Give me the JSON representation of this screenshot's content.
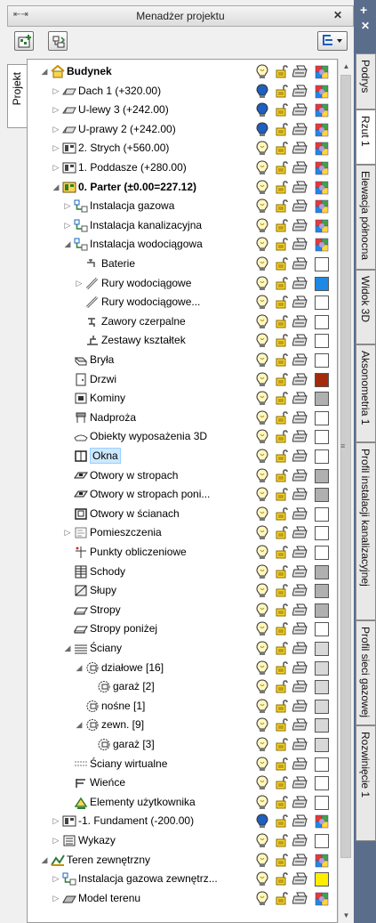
{
  "window": {
    "title": "Menadżer projektu",
    "pin_label": "⇤⇥",
    "close_label": "✕"
  },
  "left_tab": {
    "label": "Projekt"
  },
  "right_tabs": [
    {
      "label": "Podrys"
    },
    {
      "label": "Rzut 1"
    },
    {
      "label": "Elewacja północna"
    },
    {
      "label": "Widok 3D"
    },
    {
      "label": "Aksonometria 1"
    },
    {
      "label": "Profil instalacji kanalizacyjnej"
    },
    {
      "label": "Profil sieci gazowej"
    },
    {
      "label": "Rozwinięcie 1"
    }
  ],
  "tree": {
    "rows": [
      {
        "label": "Budynek",
        "arrow": "◢",
        "icon": "house-icon",
        "bold": true,
        "bulb": "yellow",
        "swatch": "multi"
      },
      {
        "label": "Dach 1 (+320.00)",
        "arrow": "▷",
        "icon": "roof-icon",
        "bulb": "blue",
        "swatch": "multi"
      },
      {
        "label": "U-lewy 3 (+242.00)",
        "arrow": "▷",
        "icon": "roof-icon",
        "bulb": "blue",
        "swatch": "multi"
      },
      {
        "label": "U-prawy 2 (+242.00)",
        "arrow": "▷",
        "icon": "roof-icon",
        "bulb": "blue",
        "swatch": "multi"
      },
      {
        "label": "2. Strych (+560.00)",
        "arrow": "▷",
        "icon": "floor-icon",
        "bulb": "yellow",
        "swatch": "multi"
      },
      {
        "label": "1. Poddasze (+280.00)",
        "arrow": "▷",
        "icon": "floor-icon",
        "bulb": "yellow",
        "swatch": "multi"
      },
      {
        "label": "0. Parter (±0.00=227.12)",
        "arrow": "◢",
        "icon": "floor-active-icon",
        "bold": true,
        "bulb": "yellow",
        "swatch": "multi"
      },
      {
        "label": "Instalacja gazowa",
        "arrow": "▷",
        "icon": "installation-icon",
        "bulb": "yellow",
        "swatch": "multi"
      },
      {
        "label": "Instalacja kanalizacyjna",
        "arrow": "▷",
        "icon": "installation-icon",
        "bulb": "yellow",
        "swatch": "multi"
      },
      {
        "label": "Instalacja wodociągowa",
        "arrow": "◢",
        "icon": "installation-icon",
        "bulb": "yellow",
        "swatch": "multi"
      },
      {
        "label": "Baterie",
        "arrow": "",
        "icon": "faucet-icon",
        "bulb": "yellow",
        "swatch": "#ffffff"
      },
      {
        "label": "Rury wodociągowe",
        "arrow": "▷",
        "icon": "pipe-icon",
        "bulb": "yellow",
        "swatch": "#1e88e5"
      },
      {
        "label": "Rury wodociągowe...",
        "arrow": "",
        "icon": "pipe-icon",
        "bulb": "yellow",
        "swatch": "#ffffff"
      },
      {
        "label": "Zawory czerpalne",
        "arrow": "",
        "icon": "valve-icon",
        "bulb": "yellow",
        "swatch": "#ffffff"
      },
      {
        "label": "Zestawy kształtek",
        "arrow": "",
        "icon": "fittings-icon",
        "bulb": "yellow",
        "swatch": "#ffffff"
      },
      {
        "label": "Bryła",
        "arrow": "",
        "icon": "solid-icon",
        "bulb": "yellow",
        "swatch": "#ffffff"
      },
      {
        "label": "Drzwi",
        "arrow": "",
        "icon": "door-icon",
        "bulb": "yellow",
        "swatch": "#a52a0c"
      },
      {
        "label": "Kominy",
        "arrow": "",
        "icon": "chimney-icon",
        "bulb": "yellow",
        "swatch": "#b0b0b0"
      },
      {
        "label": "Nadproża",
        "arrow": "",
        "icon": "lintel-icon",
        "bulb": "yellow",
        "swatch": "#ffffff"
      },
      {
        "label": "Obiekty wyposażenia 3D",
        "arrow": "",
        "icon": "furniture-icon",
        "bulb": "yellow",
        "swatch": "#ffffff"
      },
      {
        "label": "Okna",
        "arrow": "",
        "icon": "window-icon",
        "selected": true,
        "bulb": "yellow",
        "swatch": "#ffffff"
      },
      {
        "label": "Otwory w stropach",
        "arrow": "",
        "icon": "slab-opening-icon",
        "bulb": "yellow",
        "swatch": "#b0b0b0"
      },
      {
        "label": "Otwory w stropach poni...",
        "arrow": "",
        "icon": "slab-opening-icon",
        "bulb": "yellow",
        "swatch": "#b0b0b0"
      },
      {
        "label": "Otwory w ścianach",
        "arrow": "",
        "icon": "wall-opening-icon",
        "bulb": "yellow",
        "swatch": "#ffffff"
      },
      {
        "label": "Pomieszczenia",
        "arrow": "▷",
        "icon": "room-icon",
        "bulb": "yellow",
        "swatch": "#ffffff"
      },
      {
        "label": "Punkty obliczeniowe",
        "arrow": "",
        "icon": "calc-point-icon",
        "bulb": "yellow",
        "swatch": "#ffffff"
      },
      {
        "label": "Schody",
        "arrow": "",
        "icon": "stairs-icon",
        "bulb": "yellow",
        "swatch": "#b0b0b0"
      },
      {
        "label": "Słupy",
        "arrow": "",
        "icon": "column-icon",
        "bulb": "yellow",
        "swatch": "#b0b0b0"
      },
      {
        "label": "Stropy",
        "arrow": "",
        "icon": "slab-icon",
        "bulb": "yellow",
        "swatch": "#b0b0b0"
      },
      {
        "label": "Stropy poniżej",
        "arrow": "",
        "icon": "slab-icon",
        "bulb": "yellow",
        "swatch": "#ffffff"
      },
      {
        "label": "Ściany",
        "arrow": "◢",
        "icon": "wall-icon",
        "bulb": "yellow",
        "swatch": "#d8d8d8"
      },
      {
        "label": "działowe [16]",
        "arrow": "◢",
        "icon": "wall-group-icon",
        "bulb": "yellow",
        "swatch": "#d8d8d8"
      },
      {
        "label": "garaż [2]",
        "arrow": "",
        "icon": "wall-group-icon",
        "bulb": "yellow",
        "swatch": "#d8d8d8"
      },
      {
        "label": "nośne [1]",
        "arrow": "",
        "icon": "wall-group-icon",
        "bulb": "yellow",
        "swatch": "#d8d8d8"
      },
      {
        "label": "zewn. [9]",
        "arrow": "◢",
        "icon": "wall-group-icon",
        "bulb": "yellow",
        "swatch": "#d8d8d8"
      },
      {
        "label": "garaż [3]",
        "arrow": "",
        "icon": "wall-group-icon",
        "bulb": "yellow",
        "swatch": "#d8d8d8"
      },
      {
        "label": "Ściany wirtualne",
        "arrow": "",
        "icon": "virtual-wall-icon",
        "bulb": "yellow",
        "swatch": "#ffffff"
      },
      {
        "label": "Wieńce",
        "arrow": "",
        "icon": "ring-beam-icon",
        "bulb": "yellow",
        "swatch": "#ffffff"
      },
      {
        "label": "Elementy użytkownika",
        "arrow": "",
        "icon": "user-elements-icon",
        "bulb": "yellow",
        "swatch": "#ffffff"
      },
      {
        "label": "-1. Fundament (-200.00)",
        "arrow": "▷",
        "icon": "floor-icon",
        "bulb": "blue",
        "swatch": "multi"
      },
      {
        "label": "Wykazy",
        "arrow": "▷",
        "icon": "list-icon",
        "bulb": "yellow",
        "swatch": "#ffffff"
      },
      {
        "label": "Teren zewnętrzny",
        "arrow": "◢",
        "icon": "terrain-icon",
        "bulb": "yellow",
        "swatch": "multi"
      },
      {
        "label": "Instalacja gazowa zewnętrz...",
        "arrow": "▷",
        "icon": "installation-icon",
        "bulb": "yellow",
        "swatch": "#ffee00"
      },
      {
        "label": "Model terenu",
        "arrow": "▷",
        "icon": "terrain-model-icon",
        "bulb": "yellow",
        "swatch": "multi"
      }
    ]
  },
  "colors": {
    "accent": "#5a6e8c",
    "selection": "#cde8ff",
    "bulb_yellow": "#f6d32d",
    "bulb_blue": "#1f5fbf"
  }
}
